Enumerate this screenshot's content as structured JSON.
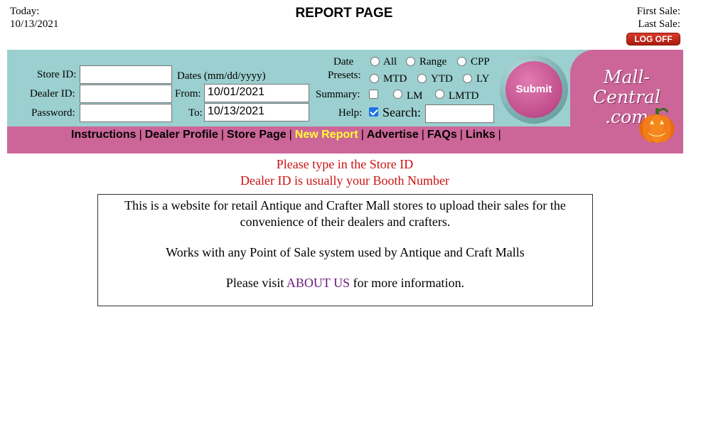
{
  "header": {
    "today_label": "Today:",
    "today_date": "10/13/2021",
    "title": "REPORT PAGE",
    "first_sale_label": "First Sale:",
    "last_sale_label": "Last Sale:",
    "logoff_label": "LOG OFF"
  },
  "form": {
    "store_id_label": "Store ID:",
    "dealer_id_label": "Dealer ID:",
    "password_label": "Password:",
    "dates_label": "Dates (mm/dd/yyyy)",
    "from_label": "From:",
    "to_label": "To:",
    "from_value": "10/01/2021",
    "to_value": "10/13/2021",
    "date_label": "Date",
    "presets_label": "Presets:",
    "summary_label": "Summary:",
    "help_label": "Help:",
    "search_label": "Search:",
    "presets": {
      "all": "All",
      "range": "Range",
      "cpp": "CPP",
      "mtd": "MTD",
      "ytd": "YTD",
      "ly": "LY",
      "lm": "LM",
      "lmtd": "LMTD"
    },
    "summary_checked": false,
    "help_checked": true,
    "submit_label": "Submit"
  },
  "logo": {
    "line1": "Mall-Central",
    "line2": ".com"
  },
  "nav": {
    "items": [
      {
        "label": "Instructions",
        "active": false
      },
      {
        "label": "Dealer Profile",
        "active": false
      },
      {
        "label": "Store Page",
        "active": false
      },
      {
        "label": "New Report",
        "active": true
      },
      {
        "label": "Advertise",
        "active": false
      },
      {
        "label": "FAQs",
        "active": false
      },
      {
        "label": "Links",
        "active": false
      }
    ],
    "separator": "|"
  },
  "messages": {
    "line1": "Please type in the Store ID",
    "line2": "Dealer ID is usually your Booth Number"
  },
  "info": {
    "paragraph1": "This is a website for retail Antique and Crafter Mall stores to upload their sales for the convenience of their dealers and crafters.",
    "paragraph2": "Works with any Point of Sale system used by Antique and Craft Malls",
    "visit_prefix": "Please visit",
    "about_link": "ABOUT US",
    "visit_suffix": "for more information."
  },
  "colors": {
    "teal_band": "#9ccfcf",
    "pink_band": "#cc6699",
    "active_nav": "#ffff33",
    "message_red": "#cc1111",
    "link_purple": "#6a1b7a"
  }
}
